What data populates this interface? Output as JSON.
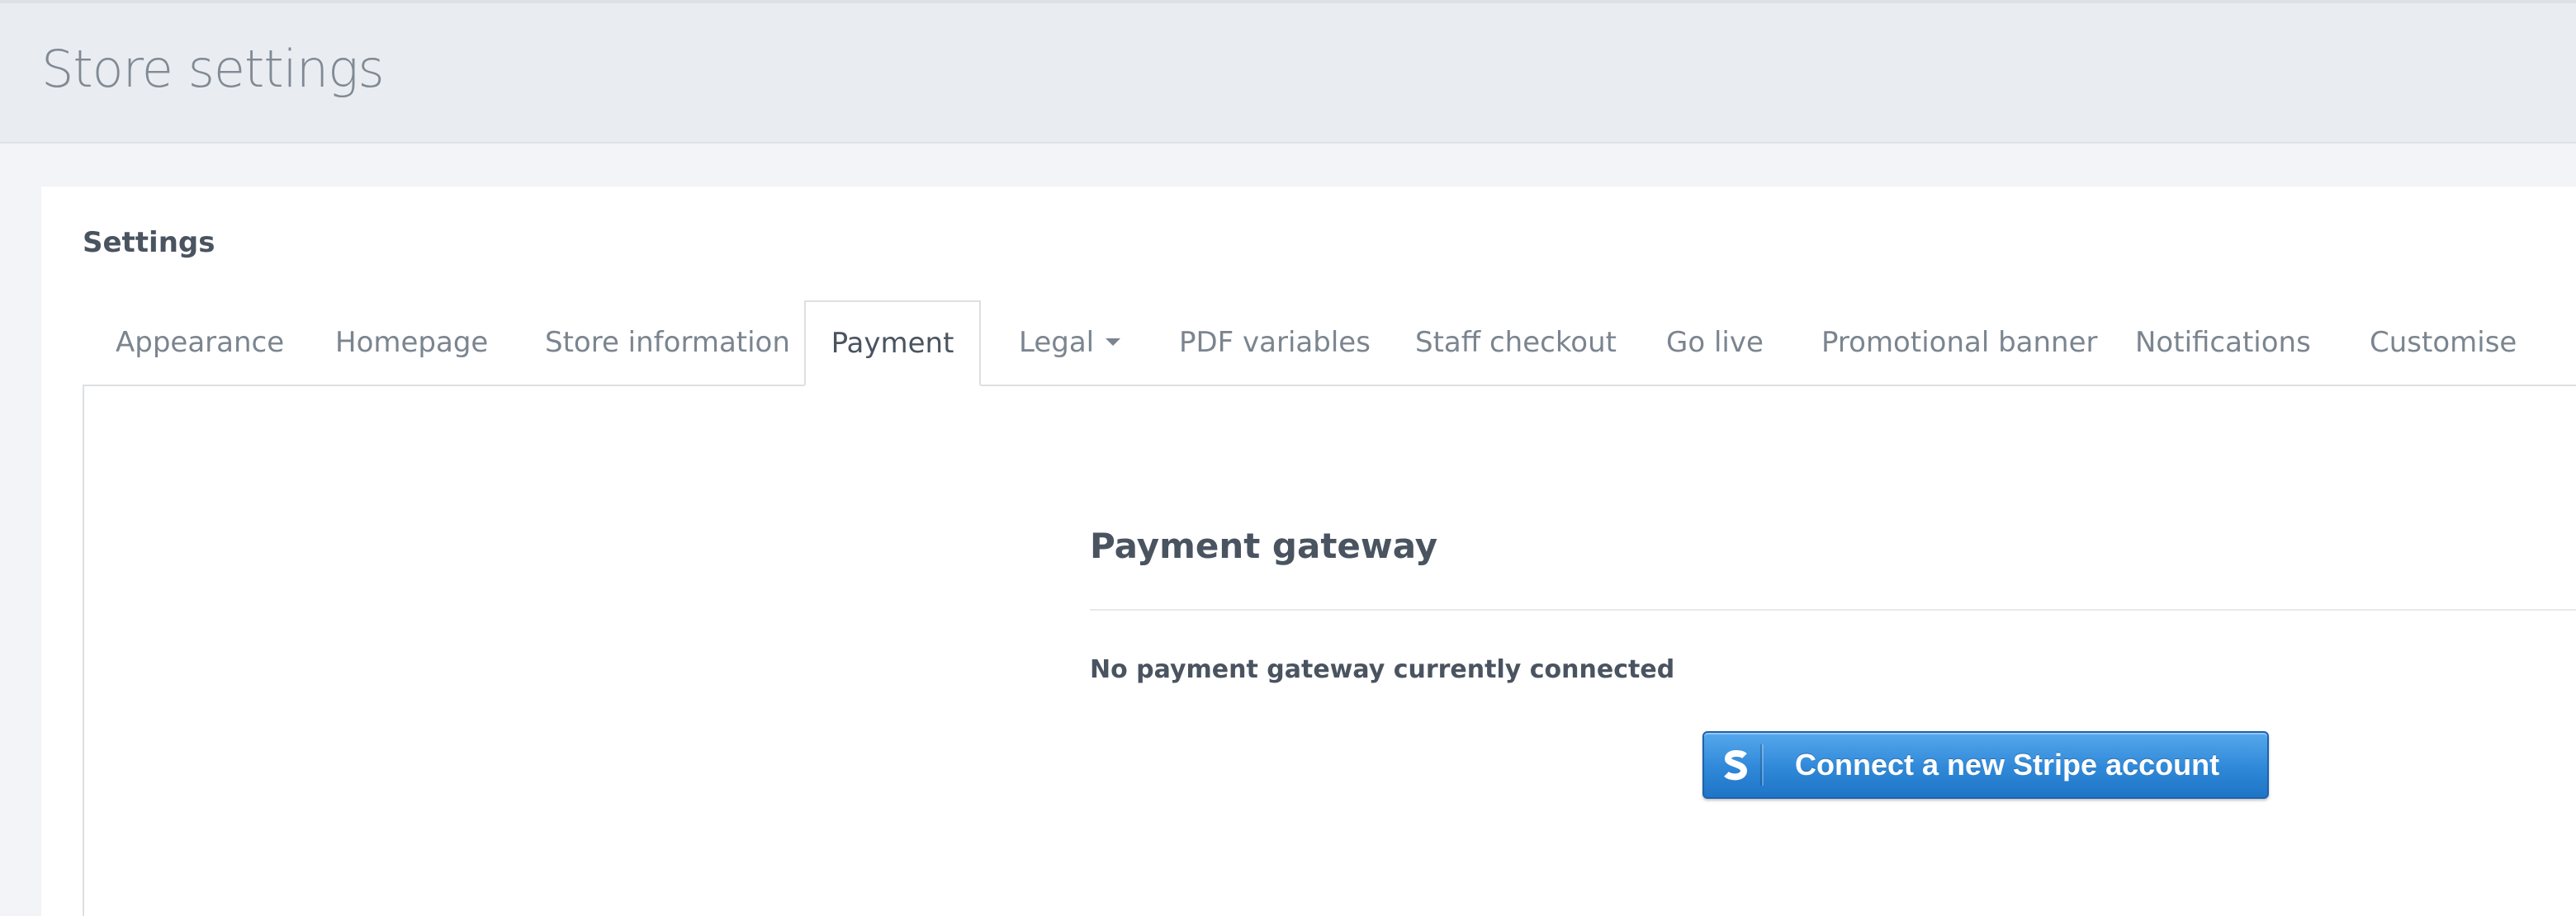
{
  "header": {
    "title": "Store settings"
  },
  "panel": {
    "heading": "Settings"
  },
  "tabs": [
    {
      "label": "Appearance"
    },
    {
      "label": "Homepage"
    },
    {
      "label": "Store information"
    },
    {
      "label": "Payment",
      "active": true
    },
    {
      "label": "Legal",
      "dropdown": true
    },
    {
      "label": "PDF variables"
    },
    {
      "label": "Staff checkout"
    },
    {
      "label": "Go live"
    },
    {
      "label": "Promotional banner"
    },
    {
      "label": "Notifications"
    },
    {
      "label": "Customise"
    }
  ],
  "payment": {
    "section_title": "Payment gateway",
    "status": "No payment gateway currently connected",
    "connect_button": {
      "label": "Connect a new Stripe account",
      "icon": "stripe-s-icon"
    }
  },
  "colors": {
    "header_bg": "#e9ecf1",
    "page_bg": "#f2f4f8",
    "stripe_blue": "#2f88d8",
    "text_dark": "#4a5460",
    "text_muted": "#7b858f"
  }
}
